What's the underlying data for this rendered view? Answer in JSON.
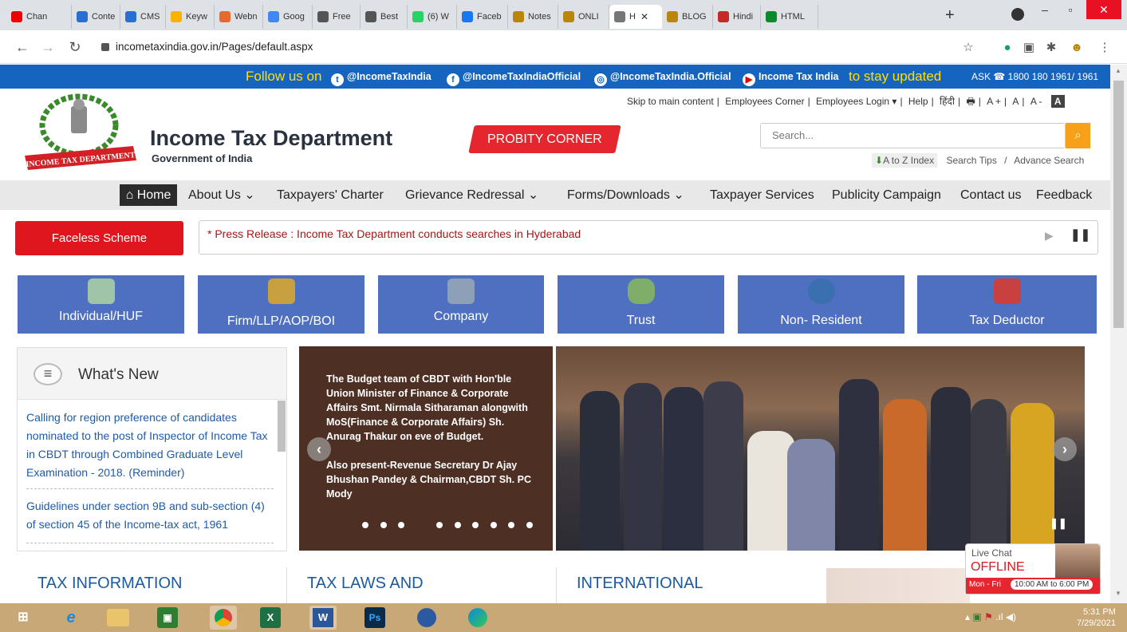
{
  "browser": {
    "tabs": [
      {
        "label": "Chan",
        "color": "#e00"
      },
      {
        "label": "Conte",
        "color": "#2a6ed1"
      },
      {
        "label": "CMS",
        "color": "#2a6ed1"
      },
      {
        "label": "Keyw",
        "color": "#f4b400"
      },
      {
        "label": "Webn",
        "color": "#e8692c"
      },
      {
        "label": "Goog",
        "color": "#4285f4"
      },
      {
        "label": "Free",
        "color": "#555"
      },
      {
        "label": "Best",
        "color": "#555"
      },
      {
        "label": "(6) W",
        "color": "#25d366"
      },
      {
        "label": "Faceb",
        "color": "#1877f2"
      },
      {
        "label": "Notes",
        "color": "#b8860b"
      },
      {
        "label": "ONLI",
        "color": "#b8860b"
      },
      {
        "label": "H",
        "color": "#777"
      },
      {
        "label": "BLOG",
        "color": "#b8860b"
      },
      {
        "label": "Hindi",
        "color": "#c62828"
      },
      {
        "label": "HTML",
        "color": "#0a8a2a"
      }
    ],
    "url": "incometaxindia.gov.in/Pages/default.aspx"
  },
  "followbar": {
    "lead": "Follow us on",
    "twitter": "@IncomeTaxIndia",
    "facebook": "@IncomeTaxIndiaOfficial",
    "instagram": "@IncomeTaxIndia.Official",
    "youtube": "Income Tax India",
    "tail": "to stay updated",
    "ask": "ASK",
    "phone": "1800 180 1961/ 1961"
  },
  "header": {
    "title": "Income Tax Department",
    "subtitle": "Government of India",
    "probity": "PROBITY CORNER",
    "logo_text": "INCOME TAX DEPARTMENT",
    "toplinks": [
      "Skip to main content",
      "Employees Corner",
      "Employees Login ▾",
      "Help",
      "हिंदी",
      "A +",
      "A",
      "A -",
      "A"
    ],
    "search_placeholder": "Search...",
    "atoz": "A to Z Index",
    "search_tips": "Search Tips",
    "advance_search": "Advance Search"
  },
  "menu": {
    "home": "Home",
    "items": [
      "About Us ⌄",
      "Taxpayers' Charter",
      "Grievance Redressal ⌄",
      "Forms/Downloads ⌄",
      "Taxpayer Services",
      "Publicity Campaign",
      "Contact us",
      "Feedback"
    ]
  },
  "faceless": "Faceless Scheme",
  "ticker": "* Press Release : Income Tax Department conducts searches in Hyderabad",
  "categories": [
    "Individual/HUF",
    "Firm/LLP/AOP/BOI",
    "Company",
    "Trust",
    "Non- Resident",
    "Tax Deductor"
  ],
  "whats_new": {
    "title": "What's New",
    "items": [
      "Calling for region preference of candidates nominated to the post of Inspector of Income Tax in CBDT through Combined Graduate Level Examination - 2018. (Reminder)",
      "Guidelines under section 9B and sub-section (4) of section 45 of the Income-tax act, 1961"
    ]
  },
  "slider": {
    "caption1": "The Budget team of CBDT with Hon'ble Union Minister of Finance & Corporate Affairs Smt. Nirmala Sitharaman alongwith MoS(Finance & Corporate Affairs) Sh. Anurag Thakur on eve of Budget.",
    "caption2": "Also present-Revenue Secretary Dr Ajay Bhushan Pandey & Chairman,CBDT Sh. PC Mody",
    "slide_count": 10,
    "active_index": 3
  },
  "sections": [
    "TAX INFORMATION",
    "TAX LAWS AND",
    "INTERNATIONAL"
  ],
  "livechat": {
    "label": "Live Chat",
    "status": "OFFLINE",
    "days": "Mon - Fri",
    "hours": "10:00 AM to 6:00 PM"
  },
  "taskbar": {
    "time": "5:31 PM",
    "date": "7/29/2021"
  }
}
